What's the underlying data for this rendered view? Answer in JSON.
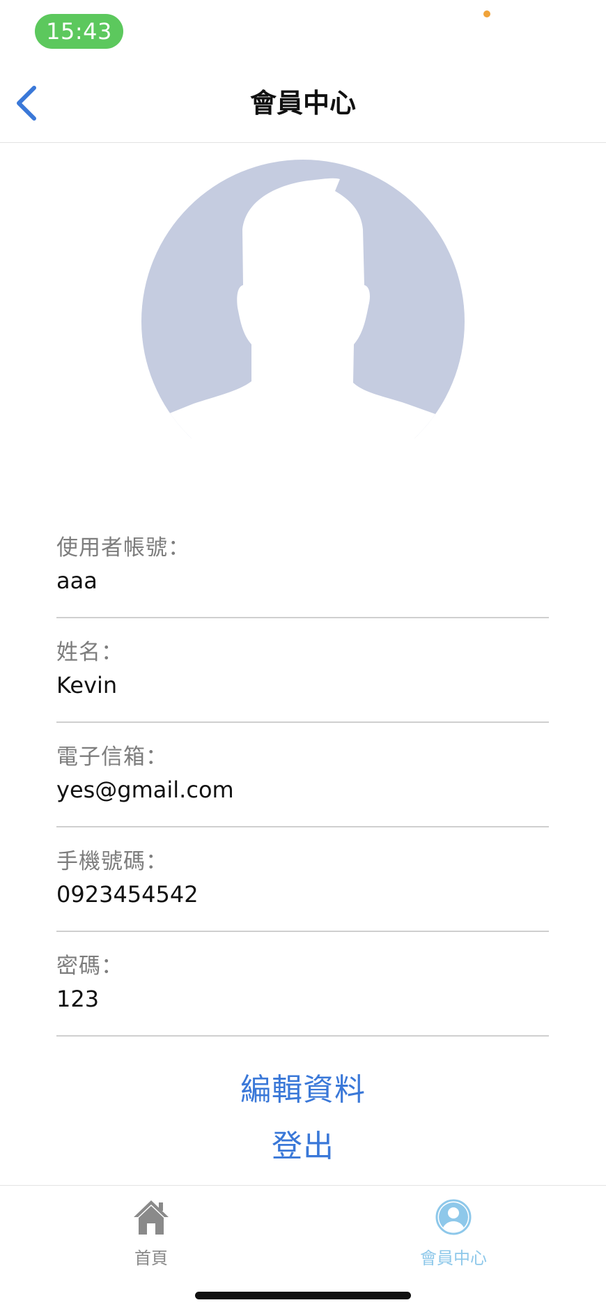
{
  "status_bar": {
    "time": "15:43"
  },
  "nav": {
    "title": "會員中心",
    "back_icon": "chevron-left-icon"
  },
  "profile": {
    "avatar_icon": "default-avatar-silhouette-icon",
    "fields": [
      {
        "label": "使用者帳號：",
        "value": "aaa"
      },
      {
        "label": "姓名：",
        "value": "Kevin"
      },
      {
        "label": "電子信箱：",
        "value": "yes@gmail.com"
      },
      {
        "label": "手機號碼：",
        "value": "0923454542"
      },
      {
        "label": "密碼：",
        "value": "123"
      }
    ]
  },
  "actions": {
    "edit_label": "編輯資料",
    "logout_label": "登出"
  },
  "tab_bar": {
    "tabs": [
      {
        "label": "首頁",
        "icon": "home-icon",
        "active": false
      },
      {
        "label": "會員中心",
        "icon": "member-icon",
        "active": true
      }
    ]
  },
  "colors": {
    "accent": "#3a78d8",
    "time_pill": "#5cc85d",
    "avatar_bg": "#c5cce0",
    "active_tab": "#8ec8ea",
    "inactive_tab": "#8a8a8a"
  }
}
